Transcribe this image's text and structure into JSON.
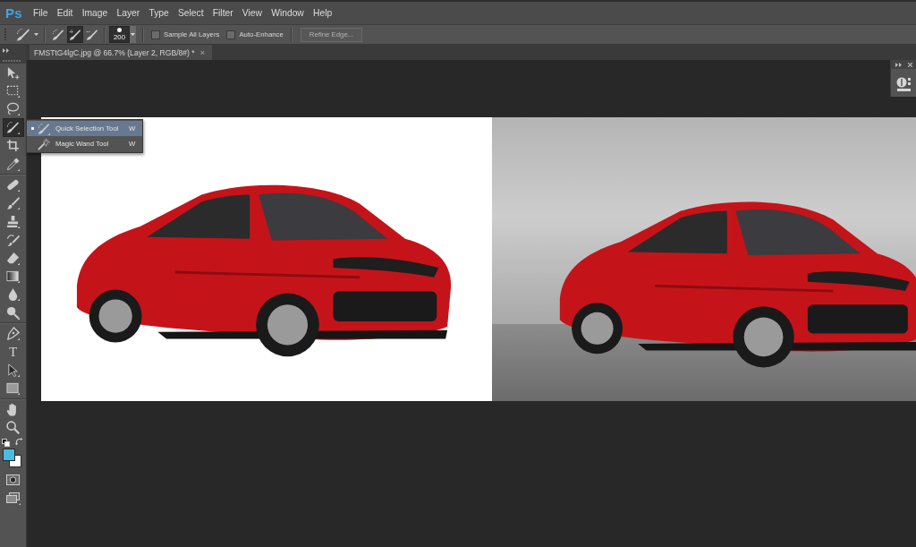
{
  "app": {
    "logo": "Ps"
  },
  "menu": [
    "File",
    "Edit",
    "Image",
    "Layer",
    "Type",
    "Select",
    "Filter",
    "View",
    "Window",
    "Help"
  ],
  "options_bar": {
    "selection_modes": [
      {
        "kind": "new",
        "selected": false
      },
      {
        "kind": "add",
        "selected": true
      },
      {
        "kind": "subtract",
        "selected": false
      }
    ],
    "brush_size": "200",
    "checkboxes": [
      {
        "label": "Sample All Layers",
        "checked": false
      },
      {
        "label": "Auto-Enhance",
        "checked": false
      }
    ],
    "refine_edge": {
      "label": "Refine Edge...",
      "disabled": true
    }
  },
  "document_tab": {
    "title": "FMSTtG4lgC.jpg @ 66.7% (Layer 2, RGB/8#) *",
    "close": "×"
  },
  "toolbar": {
    "tool_groups": [
      {
        "tools": [
          {
            "kind": "move",
            "selected": false
          },
          {
            "kind": "marquee",
            "selected": false
          },
          {
            "kind": "lasso",
            "selected": false
          },
          {
            "kind": "quick-selection",
            "selected": true
          },
          {
            "kind": "crop",
            "selected": false
          },
          {
            "kind": "eyedropper",
            "selected": false
          }
        ]
      },
      {
        "tools": [
          {
            "kind": "healing",
            "selected": false
          },
          {
            "kind": "brush",
            "selected": false
          },
          {
            "kind": "stamp",
            "selected": false
          },
          {
            "kind": "history-brush",
            "selected": false
          },
          {
            "kind": "eraser",
            "selected": false
          },
          {
            "kind": "gradient",
            "selected": false
          },
          {
            "kind": "blur",
            "selected": false
          },
          {
            "kind": "dodge",
            "selected": false
          }
        ]
      },
      {
        "tools": [
          {
            "kind": "pen",
            "selected": false
          },
          {
            "kind": "type",
            "glyph": "T",
            "selected": false
          },
          {
            "kind": "path-selection",
            "selected": false
          },
          {
            "kind": "rectangle",
            "selected": false
          }
        ]
      },
      {
        "tools": [
          {
            "kind": "hand",
            "selected": false
          },
          {
            "kind": "zoom",
            "selected": false
          }
        ]
      }
    ],
    "color_swatches": [
      {
        "kind": "foreground",
        "color": "#48bde3"
      },
      {
        "kind": "background",
        "color": "#ffffff"
      }
    ]
  },
  "tool_flyout": {
    "items": [
      {
        "kind": "quick-selection",
        "label": "Quick Selection Tool",
        "shortcut": "W",
        "selected": true
      },
      {
        "kind": "magic-wand",
        "label": "Magic Wand Tool",
        "shortcut": "W",
        "selected": false
      }
    ]
  },
  "canvas": {
    "photos": [
      {
        "kind": "studio"
      },
      {
        "kind": "wall"
      }
    ]
  }
}
